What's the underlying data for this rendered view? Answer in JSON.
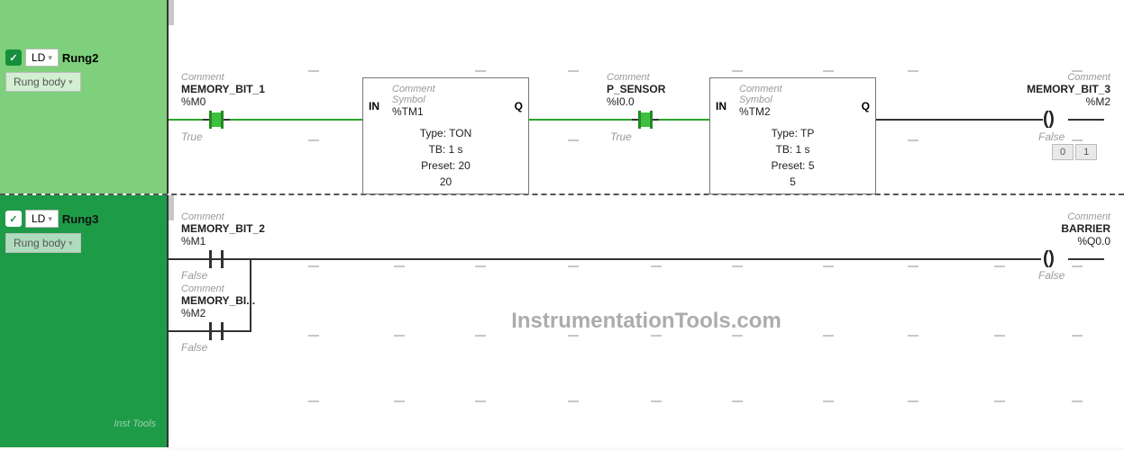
{
  "rung2": {
    "title": "Rung2",
    "ld_label": "LD",
    "body_label": "Rung body",
    "contact1": {
      "comment": "Comment",
      "name": "MEMORY_BIT_1",
      "addr": "%M0",
      "state": "True"
    },
    "timer1": {
      "comment": "Comment",
      "symbol_txt": "Symbol",
      "addr": "%TM1",
      "pin_in": "IN",
      "pin_q": "Q",
      "type_line": "Type: TON",
      "tb_line": "TB: 1 s",
      "preset_line": "Preset: 20",
      "value_line": "20"
    },
    "contact2": {
      "comment": "Comment",
      "name": "P_SENSOR",
      "addr": "%I0.0",
      "state": "True"
    },
    "timer2": {
      "comment": "Comment",
      "symbol_txt": "Symbol",
      "addr": "%TM2",
      "pin_in": "IN",
      "pin_q": "Q",
      "type_line": "Type: TP",
      "tb_line": "TB: 1 s",
      "preset_line": "Preset: 5",
      "value_line": "5"
    },
    "coil": {
      "comment": "Comment",
      "name": "MEMORY_BIT_3",
      "addr": "%M2",
      "state": "False"
    },
    "out_buttons": {
      "b0": "0",
      "b1": "1"
    }
  },
  "rung3": {
    "title": "Rung3",
    "ld_label": "LD",
    "body_label": "Rung body",
    "contactA": {
      "comment": "Comment",
      "name": "MEMORY_BIT_2",
      "addr": "%M1",
      "state": "False"
    },
    "contactB": {
      "comment": "Comment",
      "name": "MEMORY_BI...",
      "addr": "%M2",
      "state": "False"
    },
    "coil": {
      "comment": "Comment",
      "name": "BARRIER",
      "addr": "%Q0.0",
      "state": "False"
    }
  },
  "watermark": "InstrumentationTools.com",
  "corner": "Inst Tools"
}
